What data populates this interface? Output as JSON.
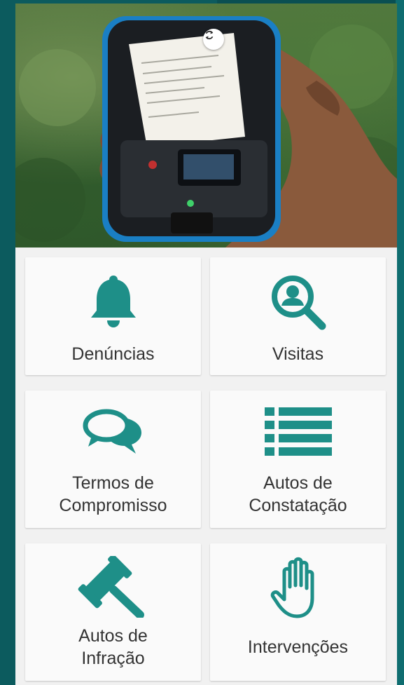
{
  "colors": {
    "accent": "#1e8f88",
    "tile_bg": "#fafafa",
    "label": "#333333",
    "frame": "#0c5b5e"
  },
  "photo": {
    "refresh_icon": "refresh-icon"
  },
  "tiles": [
    {
      "label_lines": [
        "Denúncias"
      ],
      "icon": "bell-icon"
    },
    {
      "label_lines": [
        "Visitas"
      ],
      "icon": "search-person-icon"
    },
    {
      "label_lines": [
        "Termos de",
        "Compromisso"
      ],
      "icon": "chat-bubbles-icon"
    },
    {
      "label_lines": [
        "Autos de",
        "Constatação"
      ],
      "icon": "list-icon"
    },
    {
      "label_lines": [
        "Autos de",
        "Infração"
      ],
      "icon": "gavel-icon"
    },
    {
      "label_lines": [
        "Intervenções"
      ],
      "icon": "hand-icon"
    }
  ]
}
